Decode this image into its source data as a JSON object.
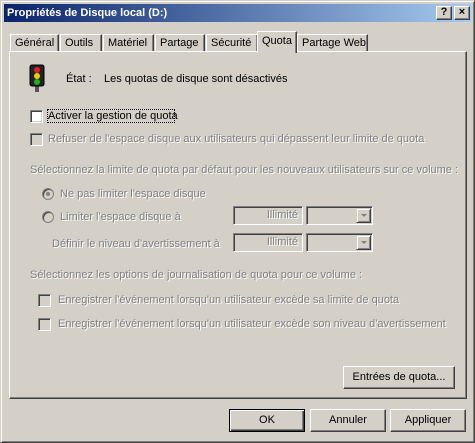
{
  "window": {
    "title": "Propriétés de Disque local (D:)",
    "help_label": "?",
    "close_label": "×"
  },
  "tabs": [
    {
      "label": "Général"
    },
    {
      "label": "Outils"
    },
    {
      "label": "Matériel"
    },
    {
      "label": "Partage"
    },
    {
      "label": "Sécurité"
    },
    {
      "label": "Quota",
      "active": true
    },
    {
      "label": "Partage Web"
    }
  ],
  "status": {
    "icon": "traffic-light-icon",
    "label": "État :",
    "value": "Les quotas de disque sont désactivés"
  },
  "options": {
    "enable_quota": {
      "label": "Activer la gestion de quota",
      "checked": false
    },
    "deny_space": {
      "label": "Refuser de l'espace disque aux utilisateurs qui dépassent leur limite de quota",
      "checked": false
    }
  },
  "limit_section": {
    "heading": "Sélectionnez la limite de quota par défaut pour les nouveaux utilisateurs sur ce volume :",
    "no_limit_label": "Ne pas limiter l'espace disque",
    "limit_label": "Limiter l'espace disque à",
    "limit_value": "Illimité",
    "limit_unit": "",
    "warning_label": "Définir le niveau d'avertissement à",
    "warning_value": "Illimité",
    "warning_unit": ""
  },
  "logging_section": {
    "heading": "Sélectionnez les options de journalisation de quota pour ce volume :",
    "log_limit_label": "Enregistrer l'événement lorsqu'un utilisateur excède sa limite de quota",
    "log_warning_label": "Enregistrer l'événement lorsqu'un utilisateur excède son niveau d'avertissement"
  },
  "buttons": {
    "quota_entries": "Entrées de quota...",
    "ok": "OK",
    "cancel": "Annuler",
    "apply": "Appliquer"
  },
  "colors": {
    "title_start": "#0a246a",
    "title_end": "#a6caf0",
    "face": "#d4d0c8"
  }
}
